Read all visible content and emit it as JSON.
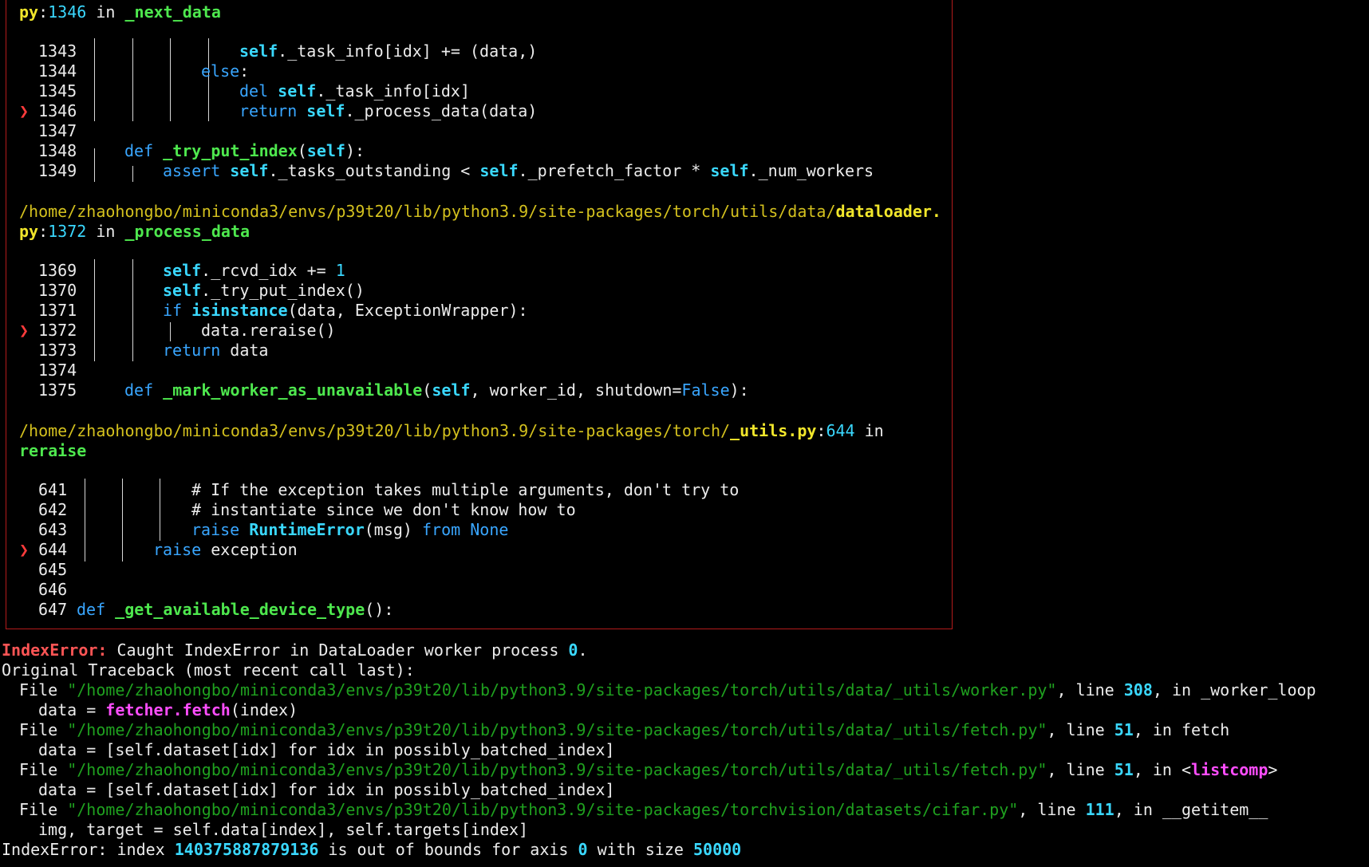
{
  "frame": {
    "f1_file_tail": "py",
    "f1_lineno": "1346",
    "f1_in": "in",
    "f1_func": "_next_data",
    "f1_lines": {
      "l1343": "1343",
      "l1344": "1344",
      "l1345": "1345",
      "l1346": "1346",
      "l1347": "1347",
      "l1348": "1348",
      "l1349": "1349"
    },
    "f2_path": "/home/zhaohongbo/miniconda3/envs/p39t20/lib/python3.9/site-packages/torch/utils/data/",
    "f2_file": "dataloader.",
    "f2_file_tail": "py",
    "f2_lineno": "1372",
    "f2_in": "in",
    "f2_func": "_process_data",
    "f2_lines": {
      "l1369": "1369",
      "l1370": "1370",
      "l1371": "1371",
      "l1372": "1372",
      "l1373": "1373",
      "l1374": "1374",
      "l1375": "1375"
    },
    "f3_path": "/home/zhaohongbo/miniconda3/envs/p39t20/lib/python3.9/site-packages/torch/",
    "f3_file": "_utils.py",
    "f3_lineno": "644",
    "f3_in": "in",
    "f3_func": "reraise",
    "f3_lines": {
      "l641": "641",
      "l642": "642",
      "l643": "643",
      "l644": "644",
      "l645": "645",
      "l646": "646",
      "l647": "647"
    },
    "marker": "❯"
  },
  "code": {
    "c1343_self": "self",
    "c1343_rest": "._task_info[idx] += (data,)",
    "c1344_else": "else",
    "c1344_colon": ":",
    "c1345_del": "del",
    "c1345_self": "self",
    "c1345_rest": "._task_info[idx]",
    "c1346_return": "return",
    "c1346_self": "self",
    "c1346_rest": "._process_data(data)",
    "c1348_def": "def",
    "c1348_name": "_try_put_index",
    "c1348_self": "self",
    "c1348_open": "(",
    "c1348_close": "):",
    "c1349_assert": "assert",
    "c1349_self1": "self",
    "c1349_rest1": "._tasks_outstanding < ",
    "c1349_self2": "self",
    "c1349_rest2": "._prefetch_factor * ",
    "c1349_self3": "self",
    "c1349_rest3": "._num_workers",
    "c1369_self": "self",
    "c1369_rest": "._rcvd_idx += ",
    "c1369_one": "1",
    "c1370_self": "self",
    "c1370_rest": "._try_put_index()",
    "c1371_if": "if",
    "c1371_isinstance": "isinstance",
    "c1371_rest": "(data, ExceptionWrapper):",
    "c1372_text": "data.reraise()",
    "c1373_return": "return",
    "c1373_rest": " data",
    "c1375_def": "def",
    "c1375_name": "_mark_worker_as_unavailable",
    "c1375_open": "(",
    "c1375_self": "self",
    "c1375_mid": ", worker_id, shutdown=",
    "c1375_false": "False",
    "c1375_close": "):",
    "c641_text": "# If the exception takes multiple arguments, don't try to",
    "c642_text": "# instantiate since we don't know how to",
    "c643_raise": "raise",
    "c643_cls": "RuntimeError",
    "c643_mid": "(msg) ",
    "c643_from": "from",
    "c643_none": "None",
    "c644_raise": "raise",
    "c644_rest": " exception",
    "c647_def": "def",
    "c647_name": "_get_available_device_type",
    "c647_rest": "():"
  },
  "traceback": {
    "err1_type": "IndexError:",
    "err1_msg": " Caught IndexError in DataLoader worker process ",
    "err1_num": "0",
    "err1_dot": ".",
    "orig_head": "Original Traceback ",
    "orig_paren": "(most recent call last):",
    "file_kw": "File",
    "t1_path": "\"/home/zhaohongbo/miniconda3/envs/p39t20/lib/python3.9/site-packages/torch/utils/data/_utils/worker.py\"",
    "t1_line_kw": ", line ",
    "t1_lineno": "308",
    "t1_in": ", in _worker_loop",
    "t1_code_pre": "data = ",
    "t1_code_call": "fetcher.fetch",
    "t1_code_post": "(index)",
    "t2_path": "\"/home/zhaohongbo/miniconda3/envs/p39t20/lib/python3.9/site-packages/torch/utils/data/_utils/fetch.py\"",
    "t2_line_kw": ", line ",
    "t2_lineno": "51",
    "t2_in": ", in fetch",
    "t2_code": "data = [self.dataset[idx] for idx in possibly_batched_index]",
    "t3_path": "\"/home/zhaohongbo/miniconda3/envs/p39t20/lib/python3.9/site-packages/torch/utils/data/_utils/fetch.py\"",
    "t3_line_kw": ", line ",
    "t3_lineno": "51",
    "t3_in": ", in <",
    "t3_func": "listcomp",
    "t3_gt": ">",
    "t3_code": "data = [self.dataset[idx] for idx in possibly_batched_index]",
    "t4_path": "\"/home/zhaohongbo/miniconda3/envs/p39t20/lib/python3.9/site-packages/torchvision/datasets/cifar.py\"",
    "t4_line_kw": ", line ",
    "t4_lineno": "111",
    "t4_in": ", in __getitem__",
    "t4_code": "img, target = self.data[index], self.targets[index]",
    "final_pre": "IndexError: index ",
    "final_idx": "140375887879136",
    "final_mid": " is out of bounds for axis ",
    "final_axis": "0",
    "final_with": " with size ",
    "final_size": "50000"
  },
  "colors": {
    "background": "#000000",
    "frame_border": "#b31b1b",
    "yellow": "#f1e62b",
    "cyan": "#3ad8ff",
    "green": "#4ee84e",
    "blue": "#39a6ff",
    "red": "#ff3b3b",
    "magenta": "#ff4dff",
    "path_dark_green": "#1fa11f"
  }
}
